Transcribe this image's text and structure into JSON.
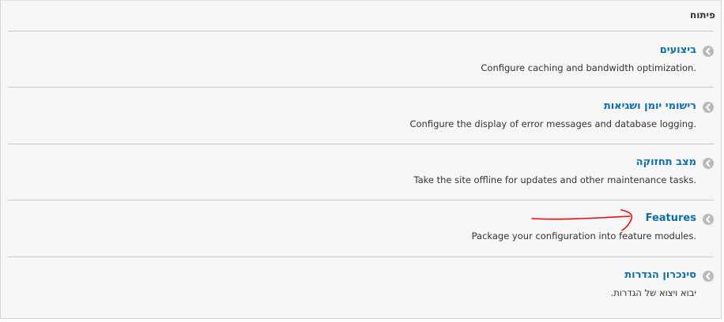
{
  "panel": {
    "title": "פיתוח"
  },
  "items": [
    {
      "link": "ביצועים",
      "description": "Configure caching and bandwidth optimization."
    },
    {
      "link": "רישומי יומן ושגיאות",
      "description": "Configure the display of error messages and database logging."
    },
    {
      "link": "מצב תחזוקה",
      "description": "Take the site offline for updates and other maintenance tasks."
    },
    {
      "link": "Features",
      "description": "Package your configuration into feature modules."
    },
    {
      "link": "סינכרון הגדרות",
      "description": "יבוא ויצוא של הגדרות."
    }
  ],
  "colors": {
    "link": "#0c6fa8",
    "annotation": "#e01010",
    "chevron": "#b9b9b9"
  },
  "icons": {
    "item_icon": "chevron-left-icon"
  }
}
